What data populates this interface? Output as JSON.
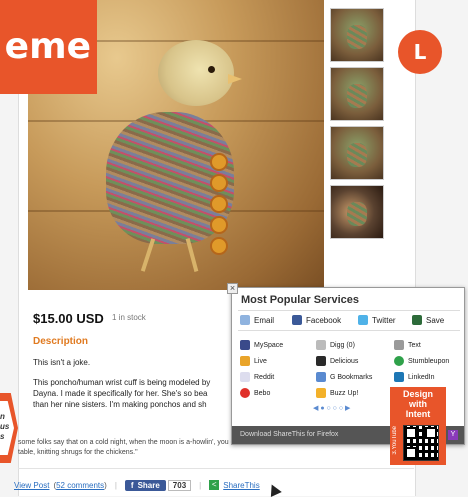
{
  "header": {
    "theme_word": "eme",
    "avatar_letter": "L"
  },
  "product": {
    "price": "$15.00 USD",
    "stock": "1 in stock",
    "description_heading": "Description",
    "paragraph_1": "This isn't a joke.",
    "paragraph_2_line1": "This poncho/human wrist cuff is being modeled by",
    "paragraph_2_line2": "Dayna. I made it specifically for her. She's so bea",
    "paragraph_2_line3": "than her nine sisters. I'm making ponchos and sh",
    "paragraph_3_line1": "some folks say that on a cold night, when the moon is a-howlin', you can still see her at the old farmhouse",
    "paragraph_3_line2": "table, knitting shrugs for the chickens.\""
  },
  "side_badge": {
    "line1": "n",
    "line2": "us",
    "line3": "s"
  },
  "footer": {
    "view_post": "View Post",
    "comments_open": "(",
    "comments": "52 comments",
    "comments_close": ")",
    "fb_share": "Share",
    "fb_count": "703",
    "sharethis": "ShareThis"
  },
  "share_popup": {
    "title": "Most Popular Services",
    "close": "×",
    "top_services": [
      "Email",
      "Facebook",
      "Twitter",
      "Save"
    ],
    "services": [
      [
        "MySpace",
        "Digg (0)",
        "Text"
      ],
      [
        "Live",
        "Delicious",
        "Stumbleupon"
      ],
      [
        "Reddit",
        "G Bookmarks",
        "LinkedIn"
      ],
      [
        "Bebo",
        "Buzz Up!",
        ""
      ]
    ],
    "pager": "◀ ● ○ ○ ○ ▶",
    "footer_text": "Download ShareThis for Firefox",
    "footer_badge": "Y"
  },
  "intent_ad": {
    "line1": "Design",
    "line2": "with",
    "line3": "Intent",
    "side_text": "3.YouTube"
  },
  "colors": {
    "accent": "#e8552a",
    "link": "#2a6ec0",
    "desc_heading": "#e07a20",
    "facebook": "#3b5998"
  }
}
